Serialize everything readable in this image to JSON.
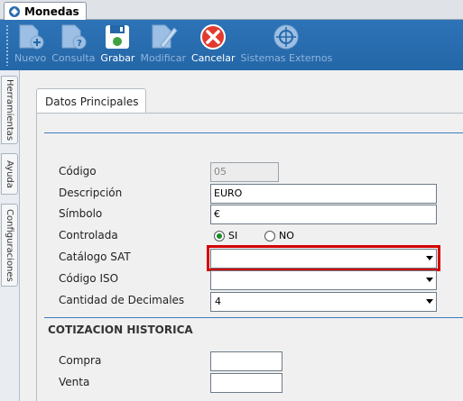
{
  "window": {
    "tab_title": "Monedas"
  },
  "toolbar": {
    "buttons": [
      {
        "label": "Nuevo",
        "icon": "new-document-icon",
        "enabled": false
      },
      {
        "label": "Consulta",
        "icon": "query-document-icon",
        "enabled": false
      },
      {
        "label": "Grabar",
        "icon": "save-icon",
        "enabled": true
      },
      {
        "label": "Modificar",
        "icon": "edit-icon",
        "enabled": false
      },
      {
        "label": "Cancelar",
        "icon": "cancel-icon",
        "enabled": true
      },
      {
        "label": "Sistemas Externos",
        "icon": "external-systems-icon",
        "enabled": false
      }
    ]
  },
  "side_tabs": [
    "Herramientas",
    "Ayuda",
    "Configuraciones"
  ],
  "section_tab": "Datos Principales",
  "form": {
    "codigo": {
      "label": "Código",
      "value": "05"
    },
    "descripcion": {
      "label": "Descripción",
      "value": "EURO"
    },
    "simbolo": {
      "label": "Símbolo",
      "value": "€"
    },
    "controlada": {
      "label": "Controlada",
      "options": [
        "SI",
        "NO"
      ],
      "selected": "SI"
    },
    "catalogo_sat": {
      "label": "Catálogo SAT",
      "value": ""
    },
    "codigo_iso": {
      "label": "Código ISO",
      "value": ""
    },
    "cantidad_decimales": {
      "label": "Cantidad de Decimales",
      "value": "4"
    }
  },
  "cotizacion": {
    "heading": "COTIZACION HISTORICA",
    "compra": {
      "label": "Compra",
      "value": ""
    },
    "venta": {
      "label": "Venta",
      "value": ""
    }
  },
  "colors": {
    "toolbar": "#2467a8",
    "accent_line": "#3f7bbf",
    "highlight": "#d40000",
    "radio_selected": "#1a8a2a"
  }
}
